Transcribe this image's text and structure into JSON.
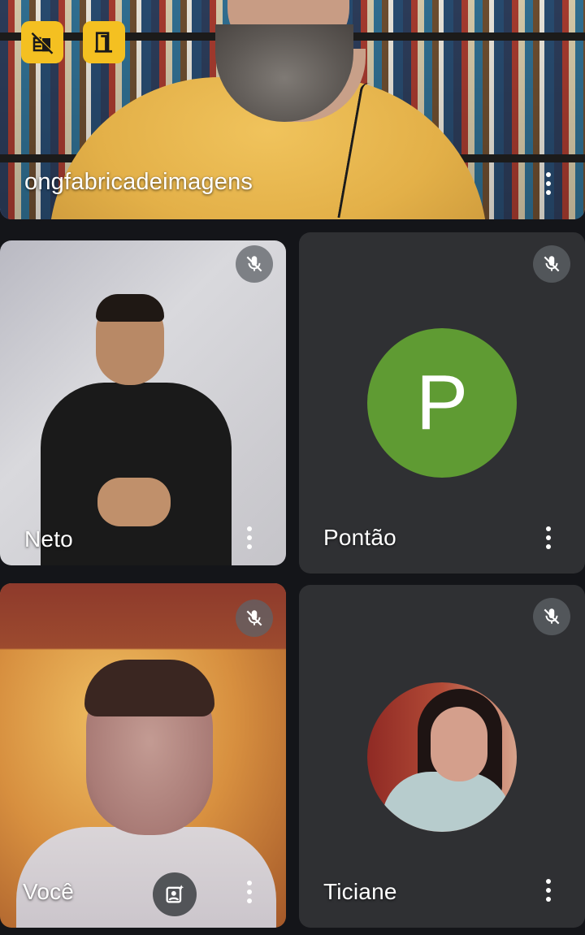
{
  "call": {
    "top_tile": {
      "name": "ongfabricadeimagens",
      "left_button_icon": "cell-signal-off-icon",
      "right_button_icon": "door-exit-icon",
      "more_icon": "more-vert-icon",
      "highlight_color": "#8c9aff",
      "button_color": "#f4c021"
    },
    "participants": [
      {
        "name": "Neto",
        "muted": true,
        "more_icon": "more-vert-icon"
      },
      {
        "name": "Pontão",
        "avatar_letter": "P",
        "avatar_color": "#5f9b33",
        "muted": true,
        "more_icon": "more-vert-icon"
      },
      {
        "name": "Você",
        "muted": true,
        "self_view_icon": "portrait-effects-icon",
        "more_icon": "more-vert-icon"
      },
      {
        "name": "Ticiane",
        "muted": true,
        "more_icon": "more-vert-icon"
      }
    ]
  },
  "colors": {
    "background": "#141519",
    "tile_dark": "#2f3033",
    "mute_badge": "#5f6368"
  }
}
